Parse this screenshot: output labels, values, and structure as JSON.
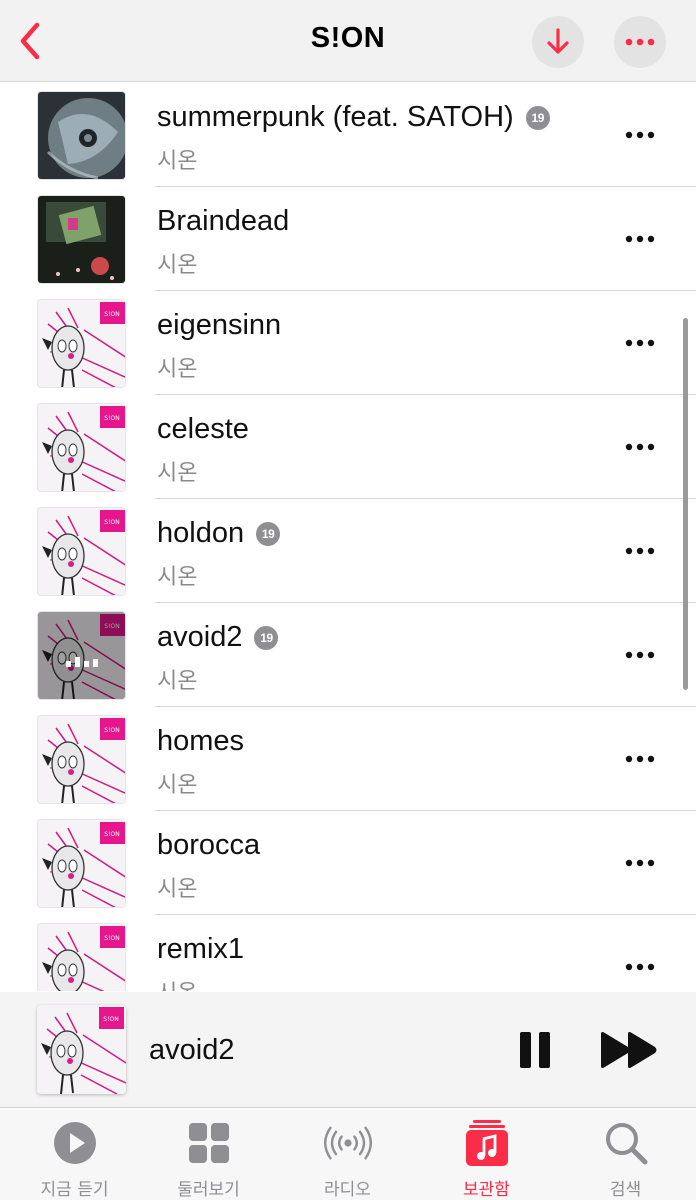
{
  "colors": {
    "accent": "#fa2d48",
    "secondary_text": "#8a8a8a",
    "explicit_badge": "#8e8e93"
  },
  "header": {
    "title": "S!ON",
    "back_icon": "chevron-left-icon",
    "download_icon": "arrow-down-icon",
    "more_icon": "ellipsis-icon"
  },
  "tracks": [
    {
      "title": "summerpunk (feat. SATOH)",
      "artist": "시온",
      "explicit": true,
      "explicit_label": "19",
      "artwork": "cd-disc-art"
    },
    {
      "title": "Braindead",
      "artist": "시온",
      "explicit": false,
      "artwork": "dark-scene-art"
    },
    {
      "title": "eigensinn",
      "artist": "시온",
      "explicit": false,
      "artwork": "sion-album-art"
    },
    {
      "title": "celeste",
      "artist": "시온",
      "explicit": false,
      "artwork": "sion-album-art"
    },
    {
      "title": "holdon",
      "artist": "시온",
      "explicit": true,
      "explicit_label": "19",
      "artwork": "sion-album-art"
    },
    {
      "title": "avoid2",
      "artist": "시온",
      "explicit": true,
      "explicit_label": "19",
      "artwork": "sion-album-art-playing",
      "now_playing": true
    },
    {
      "title": "homes",
      "artist": "시온",
      "explicit": false,
      "artwork": "sion-album-art"
    },
    {
      "title": "borocca",
      "artist": "시온",
      "explicit": false,
      "artwork": "sion-album-art"
    },
    {
      "title": "remix1",
      "artist": "시온",
      "explicit": false,
      "artwork": "sion-album-art"
    }
  ],
  "mini_player": {
    "title": "avoid2",
    "pause_icon": "pause-icon",
    "skip_icon": "forward-icon"
  },
  "tabs": [
    {
      "label": "지금 듣기",
      "icon": "play-circle-icon",
      "active": false
    },
    {
      "label": "둘러보기",
      "icon": "grid-icon",
      "active": false
    },
    {
      "label": "라디오",
      "icon": "radio-waves-icon",
      "active": false
    },
    {
      "label": "보관함",
      "icon": "library-icon",
      "active": true
    },
    {
      "label": "검색",
      "icon": "search-icon",
      "active": false
    }
  ]
}
